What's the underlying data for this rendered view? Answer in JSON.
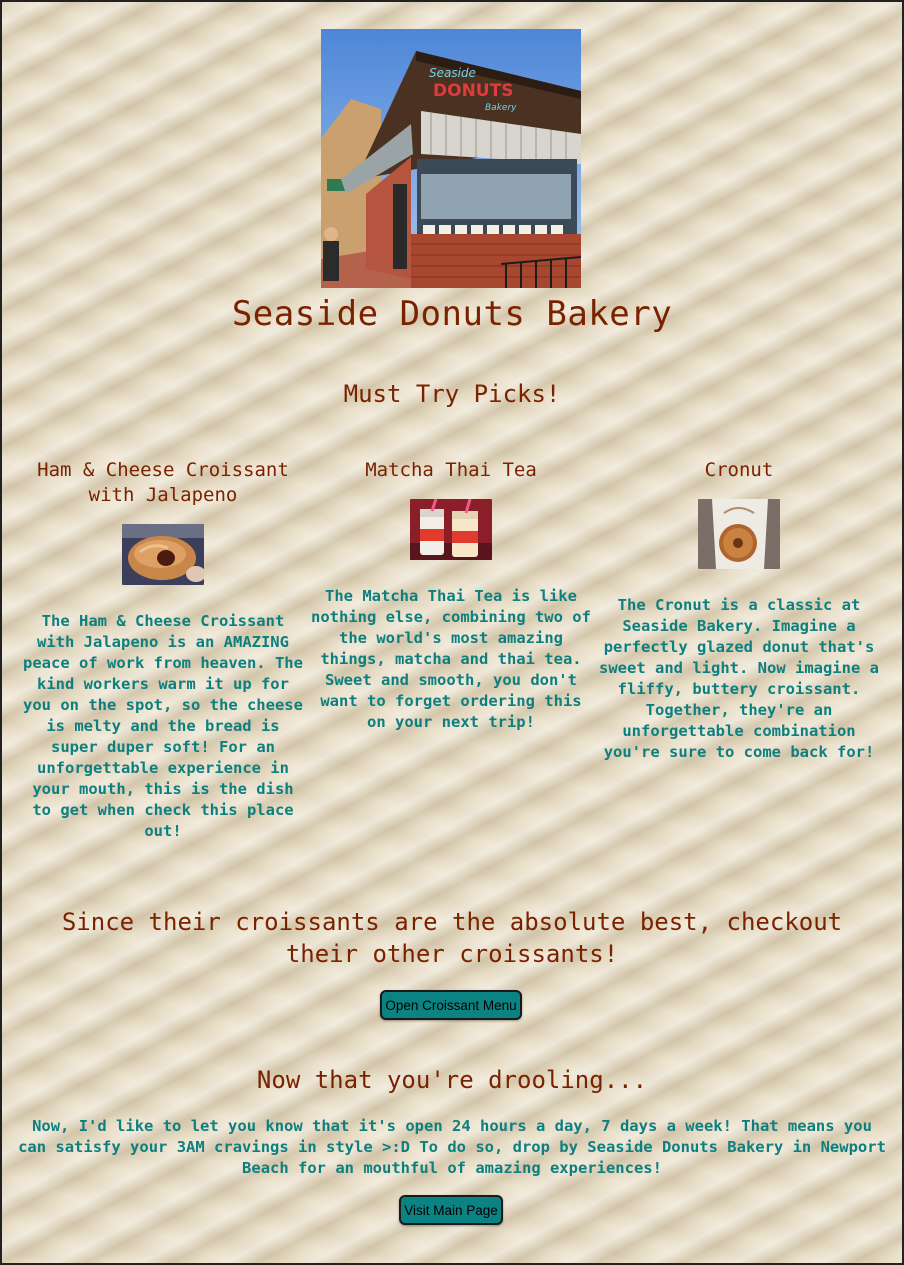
{
  "site": {
    "title": "Seaside Donuts Bakery",
    "storefront_sign": {
      "line1": "Seaside",
      "line2": "DONUTS",
      "line3": "Bakery"
    }
  },
  "picks": {
    "heading": "Must Try Picks!",
    "items": [
      {
        "title": "Ham & Cheese Croissant with Jalapeno",
        "image": "croissant-photo",
        "description": "The Ham & Cheese Croissant with Jalapeno is an AMAZING peace of work from heaven. The kind workers warm it up for you on the spot, so the cheese is melty and the bread is super duper soft! For an unforgettable experience in your mouth, this is the dish to get when check this place out!"
      },
      {
        "title": "Matcha Thai Tea",
        "image": "tea-cups-photo",
        "description": "The Matcha Thai Tea is like nothing else, combining two of the world's most amazing things, matcha and thai tea. Sweet and smooth, you don't want to forget ordering this on your next trip!"
      },
      {
        "title": "Cronut",
        "image": "cronut-photo",
        "description": "The Cronut is a classic at Seaside Bakery. Imagine a perfectly glazed donut that's sweet and light. Now imagine a fliffy, buttery croissant. Together, they're an unforgettable combination you're sure to come back for!"
      }
    ]
  },
  "croissants": {
    "heading": "Since their croissants are the absolute best, checkout their other croissants!",
    "button_label": "Open Croissant Menu"
  },
  "closing": {
    "heading": "Now that you're drooling...",
    "text": "Now, I'd like to let you know that it's open 24 hours a day, 7 days a week! That means you can satisfy your 3AM cravings in style >:D To do so, drop by Seaside Donuts Bakery in Newport Beach for an mouthful of amazing experiences!",
    "button_label": "Visit Main Page"
  },
  "colors": {
    "heading": "#7a2200",
    "body_text": "#0e7f7f",
    "button_bg": "#0b8383",
    "background": "#e8ddc4"
  }
}
